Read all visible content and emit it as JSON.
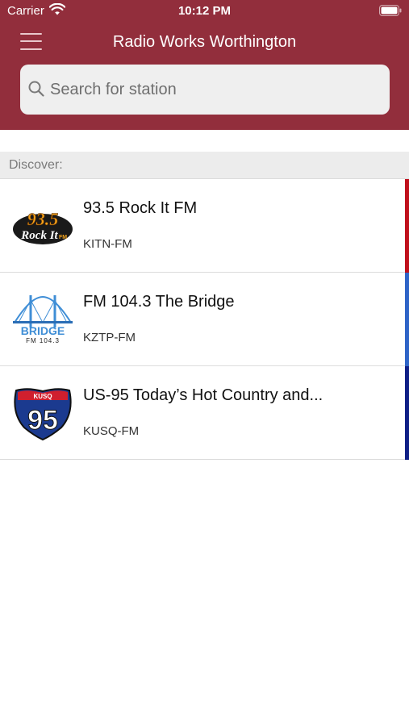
{
  "status_bar": {
    "carrier": "Carrier",
    "time": "10:12 PM"
  },
  "header": {
    "title": "Radio Works Worthington",
    "background_color": "#922e3c",
    "menu_icon": "hamburger-menu-icon"
  },
  "search": {
    "placeholder": "Search for station",
    "value": "",
    "icon": "search-icon"
  },
  "section": {
    "label": "Discover:"
  },
  "stations": [
    {
      "name": "93.5 Rock It FM",
      "call_sign": "KITN-FM",
      "accent_color": "#c0101c",
      "logo": {
        "line1": "93.5",
        "line2": "Rock It",
        "line3": "FM"
      }
    },
    {
      "name": "FM 104.3 The Bridge",
      "call_sign": "KZTP-FM",
      "accent_color": "#2e64c7",
      "logo": {
        "line1": "BRIDGE",
        "line2": "FM 104.3"
      }
    },
    {
      "name": "US-95 Today’s Hot Country and...",
      "call_sign": "KUSQ-FM",
      "accent_color": "#0f1f86",
      "logo": {
        "line1": "KUSQ",
        "line2": "95"
      }
    }
  ]
}
